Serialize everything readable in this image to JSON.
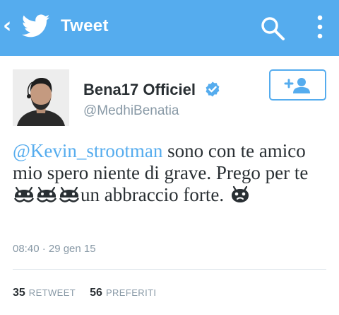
{
  "actionbar": {
    "title": "Tweet",
    "background_color": "#55acee",
    "back_icon": "chevron-left-icon",
    "logo_icon": "twitter-bird-icon",
    "search_icon": "search-icon",
    "overflow_icon": "more-vertical-icon"
  },
  "author": {
    "name": "Bena17 Officiel",
    "handle": "@MedhiBenatia",
    "verified": true,
    "verified_icon": "verified-badge-icon",
    "follow_icon": "add-user-icon"
  },
  "tweet": {
    "mention": "@Kevin_strootman",
    "text_after_mention": " sono con te amico mio spero niente di grave. Prego per te ",
    "text_after_emoji": "un abbraccio forte. ",
    "emoji_icon": "android-emoji-icon",
    "timestamp": "08:40 · 29 gen 15"
  },
  "stats": {
    "retweets": "35",
    "retweets_label": "RETWEET",
    "favorites": "56",
    "favorites_label": "PREFERITI"
  },
  "colors": {
    "accent": "#55acee",
    "text": "#292f33",
    "muted": "#8899a6",
    "divider": "#e1e8ed"
  }
}
